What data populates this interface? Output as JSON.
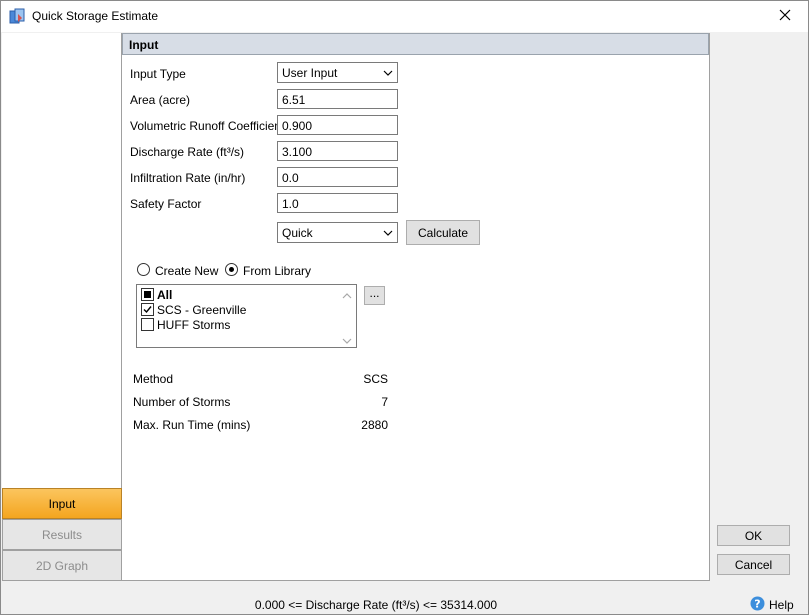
{
  "window": {
    "title": "Quick Storage Estimate"
  },
  "nav": {
    "items": [
      {
        "label": "Input",
        "active": true
      },
      {
        "label": "Results",
        "active": false
      },
      {
        "label": "2D Graph",
        "active": false
      }
    ]
  },
  "section": {
    "title": "Input"
  },
  "form": {
    "input_type": {
      "label": "Input Type",
      "value": "User Input"
    },
    "area": {
      "label": "Area (acre)",
      "value": "6.51"
    },
    "runoff": {
      "label": "Volumetric Runoff Coefficient",
      "value": "0.900"
    },
    "discharge": {
      "label": "Discharge Rate (ft³/s)",
      "value": "3.100"
    },
    "infiltration": {
      "label": "Infiltration Rate (in/hr)",
      "value": "0.0"
    },
    "safety": {
      "label": "Safety Factor",
      "value": "1.0"
    },
    "mode": {
      "value": "Quick"
    },
    "calculate_label": "Calculate"
  },
  "storms": {
    "create_new_label": "Create New",
    "from_library_label": "From Library",
    "selected": "from_library",
    "items": [
      {
        "label": "All",
        "state": "indeterminate",
        "bold": true
      },
      {
        "label": "SCS - Greenville",
        "state": "checked",
        "bold": false
      },
      {
        "label": "HUFF Storms",
        "state": "unchecked",
        "bold": false
      }
    ],
    "browse_label": "..."
  },
  "summary": {
    "rows": [
      {
        "label": "Method",
        "value": "SCS"
      },
      {
        "label": "Number of Storms",
        "value": "7"
      },
      {
        "label": "Max. Run Time (mins)",
        "value": "2880"
      }
    ]
  },
  "footer": {
    "ok_label": "OK",
    "cancel_label": "Cancel",
    "status_text": "0.000 <= Discharge Rate (ft³/s) <= 35314.000",
    "help_label": "Help"
  },
  "colors": {
    "accent": "#f4a51f",
    "header_bg": "#d7dde6"
  }
}
